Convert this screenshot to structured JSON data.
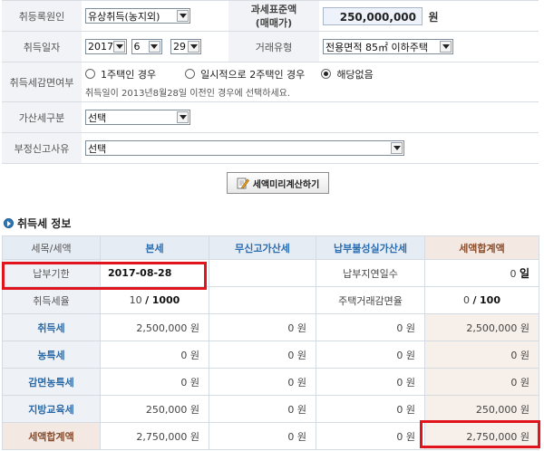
{
  "form": {
    "reason": {
      "label": "취등록원인",
      "value": "유상취득(농지외)"
    },
    "tax_base": {
      "label_line1": "과세표준액",
      "label_line2": "(매매가)",
      "value": "250,000,000",
      "unit": "원"
    },
    "acq_date": {
      "label": "취득일자",
      "year": "2017",
      "month": "6",
      "day": "29"
    },
    "trade_type": {
      "label": "거래유형",
      "value": "전용면적 85㎡ 이하주택"
    },
    "reduction": {
      "label": "취득세감면여부",
      "options": [
        "1주택인 경우",
        "일시적으로 2주택인 경우",
        "해당없음"
      ],
      "selected_index": 2,
      "note": "취득일이 2013년8월28일 이전인 경우에 선택하세요."
    },
    "surcharge": {
      "label": "가산세구분",
      "value": "선택"
    },
    "improper": {
      "label": "부정신고사유",
      "value": "선택"
    }
  },
  "calc_button": {
    "label": "세액미리계산하기"
  },
  "section": {
    "title": "취득세 정보"
  },
  "tax_table": {
    "headers": [
      "세목/세액",
      "본세",
      "무신고가산세",
      "납부불성실가산세",
      "세액합계액"
    ],
    "due": {
      "label": "납부기한",
      "value": "2017-08-28",
      "delay_label": "납부지연일수",
      "delay_value": "0",
      "delay_unit": "일"
    },
    "rate": {
      "label": "취득세율",
      "num": "10",
      "den": "1000",
      "reduce_label": "주택거래감면율",
      "reduce_num": "0",
      "reduce_den": "100"
    },
    "rows": [
      {
        "label": "취득세",
        "values": [
          "2,500,000 원",
          "0 원",
          "0 원",
          "2,500,000 원"
        ]
      },
      {
        "label": "농특세",
        "values": [
          "0 원",
          "0 원",
          "0 원",
          "0 원"
        ]
      },
      {
        "label": "감면농특세",
        "values": [
          "0 원",
          "0 원",
          "0 원",
          "0 원"
        ]
      },
      {
        "label": "지방교육세",
        "values": [
          "250,000 원",
          "0 원",
          "0 원",
          "250,000 원"
        ]
      }
    ],
    "total": {
      "label": "세액합계액",
      "values": [
        "2,750,000 원",
        "0 원",
        "0 원",
        "2,750,000 원"
      ]
    }
  },
  "colors": {
    "highlight": "#e1131d",
    "accent": "#2a6cb0"
  }
}
